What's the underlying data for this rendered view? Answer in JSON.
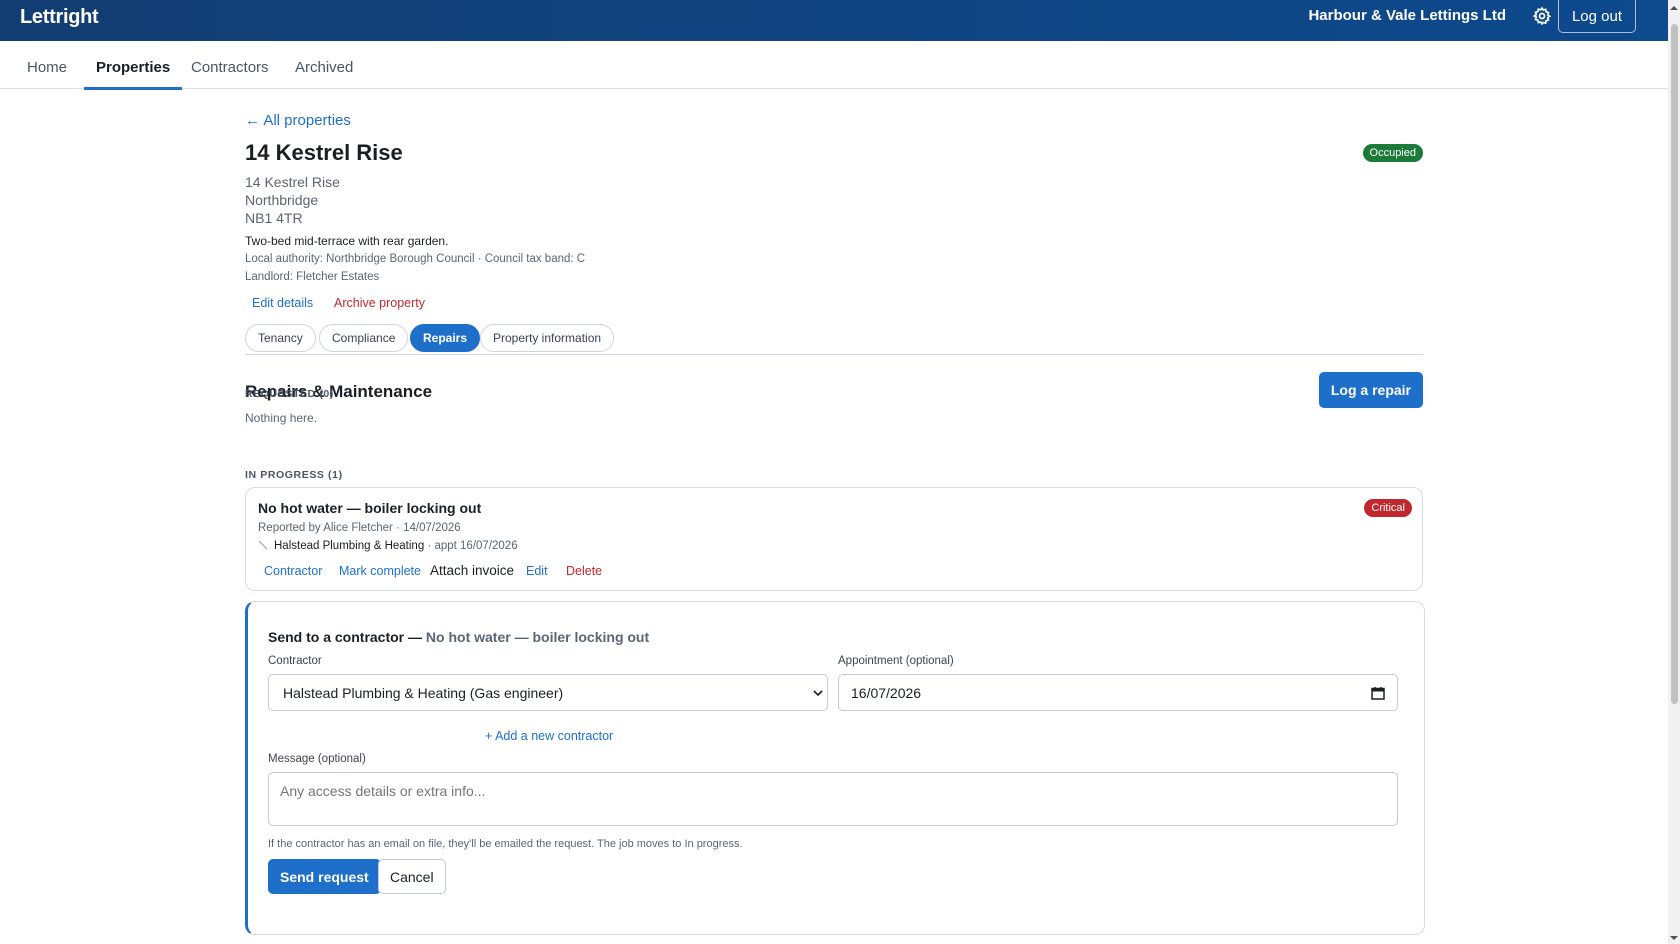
{
  "app": {
    "brand": "Lettright",
    "org": "Harbour & Vale Lettings Ltd",
    "logout_label": "Log out"
  },
  "nav": [
    {
      "label": "Home"
    },
    {
      "label": "Properties"
    },
    {
      "label": "Contractors"
    },
    {
      "label": "Archived"
    }
  ],
  "nav_active": "Properties",
  "property": {
    "back_link": "← All properties",
    "name": "14 Kestrel Rise",
    "status": "Occupied",
    "address": [
      "14 Kestrel Rise",
      "Northbridge",
      "NB1 4TR"
    ],
    "description": "Two-bed mid-terrace with rear garden.",
    "authority": "Local authority: Northbridge Borough Council · Council tax band: C",
    "landlord": "Landlord: Fletcher Estates",
    "edit_label": "Edit details",
    "archive_label": "Archive property"
  },
  "tabs": [
    {
      "label": "Tenancy"
    },
    {
      "label": "Compliance"
    },
    {
      "label": "Repairs"
    },
    {
      "label": "Property information"
    }
  ],
  "tabs_active": "Repairs",
  "repairs": {
    "title": "Repairs & Maintenance",
    "log_button": "Log a repair",
    "requested_label": "REQUESTED (0)",
    "requested_empty": "Nothing here.",
    "in_progress_label": "IN PROGRESS (1)",
    "item": {
      "title": "No hot water — boiler locking out",
      "priority": "Critical",
      "reported": "Reported by Alice Fletcher · 14/07/2026",
      "contractor": "Halstead Plumbing & Heating",
      "appointment": "· appt 16/07/2026",
      "actions": {
        "contractor": "Contractor",
        "mark_complete": "Mark complete",
        "attach_invoice": "Attach invoice",
        "edit": "Edit",
        "delete": "Delete"
      }
    }
  },
  "send_form": {
    "title": "Send to a contractor —",
    "subtitle": "No hot water — boiler locking out",
    "contractor_label": "Contractor",
    "contractor_value": "Halstead Plumbing & Heating (Gas engineer)",
    "appointment_label": "Appointment (optional)",
    "appointment_value": "16/07/2026",
    "add_contractor": "+ Add a new contractor",
    "message_label": "Message (optional)",
    "message_placeholder": "Any access details or extra info...",
    "help_text": "If the contractor has an email on file, they'll be emailed the request. The job moves to In progress.",
    "send_label": "Send request",
    "cancel_label": "Cancel"
  },
  "colors": {
    "primary": "#1e6fc9",
    "header": "#123d72",
    "occupied": "#1c7a39",
    "critical": "#c0282d"
  }
}
